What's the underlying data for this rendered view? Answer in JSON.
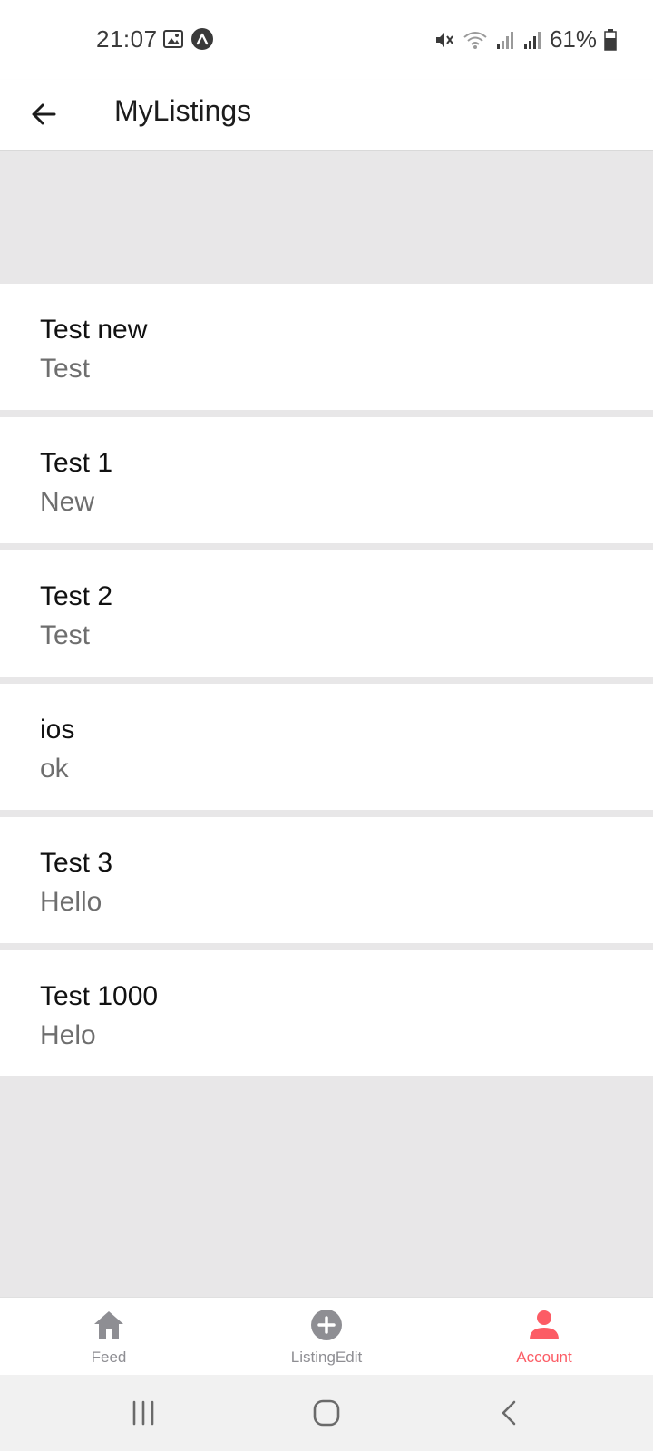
{
  "status_bar": {
    "time": "21:07",
    "battery": "61%",
    "icons": [
      "gallery-icon",
      "expo-icon",
      "mute-icon",
      "wifi-icon",
      "signal-icon",
      "signal-icon",
      "battery-icon"
    ]
  },
  "header": {
    "title": "MyListings",
    "back_icon": "arrow-left-icon"
  },
  "listings": [
    {
      "title": "Test new",
      "subtitle": "Test"
    },
    {
      "title": "Test 1",
      "subtitle": "New"
    },
    {
      "title": "Test 2",
      "subtitle": "Test"
    },
    {
      "title": "ios",
      "subtitle": "ok"
    },
    {
      "title": "Test 3",
      "subtitle": "Hello"
    },
    {
      "title": "Test 1000",
      "subtitle": "Helo"
    }
  ],
  "tabs": [
    {
      "label": "Feed",
      "icon": "home-icon",
      "active": false
    },
    {
      "label": "ListingEdit",
      "icon": "plus-circle-icon",
      "active": false
    },
    {
      "label": "Account",
      "icon": "account-icon",
      "active": true
    }
  ],
  "system_nav": [
    "recent-apps-icon",
    "home-icon",
    "back-icon"
  ],
  "colors": {
    "accent": "#fc5c65",
    "inactive": "#8e8e93",
    "background": "#e8e7e8"
  }
}
